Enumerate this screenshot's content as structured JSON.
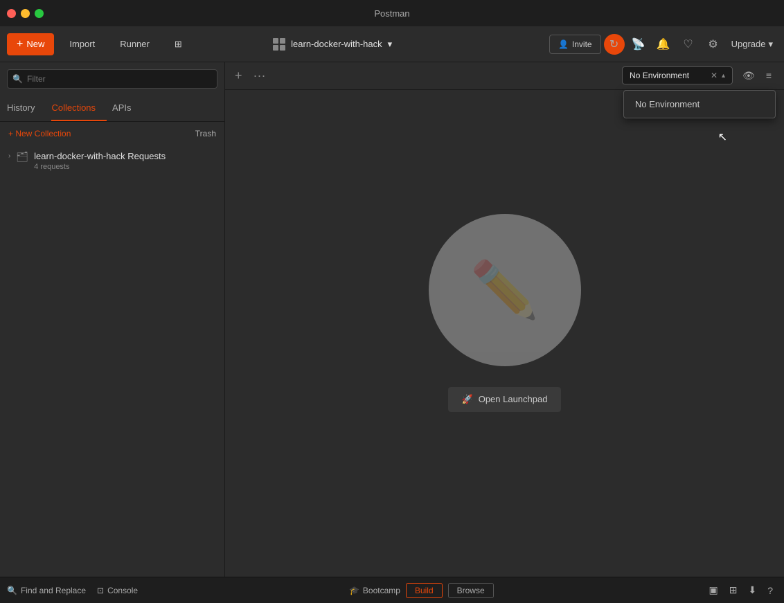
{
  "titlebar": {
    "title": "Postman"
  },
  "toolbar": {
    "new_label": "New",
    "import_label": "Import",
    "runner_label": "Runner",
    "workspace_name": "learn-docker-with-hack",
    "invite_label": "Invite",
    "upgrade_label": "Upgrade"
  },
  "sidebar": {
    "search_placeholder": "Filter",
    "tabs": [
      {
        "id": "history",
        "label": "History"
      },
      {
        "id": "collections",
        "label": "Collections",
        "active": true
      },
      {
        "id": "apis",
        "label": "APIs"
      }
    ],
    "new_collection_label": "+ New Collection",
    "trash_label": "Trash",
    "collections": [
      {
        "name": "learn-docker-with-hack Requests",
        "meta": "4 requests"
      }
    ]
  },
  "environment": {
    "selected": "No Environment",
    "options": [
      "No Environment"
    ],
    "dropdown_item": "No Environment"
  },
  "main": {
    "open_launchpad_label": "Open Launchpad",
    "placeholder_icon": "✏"
  },
  "bottom": {
    "find_replace_label": "Find and Replace",
    "console_label": "Console",
    "bootcamp_label": "Bootcamp",
    "build_label": "Build",
    "browse_label": "Browse"
  }
}
